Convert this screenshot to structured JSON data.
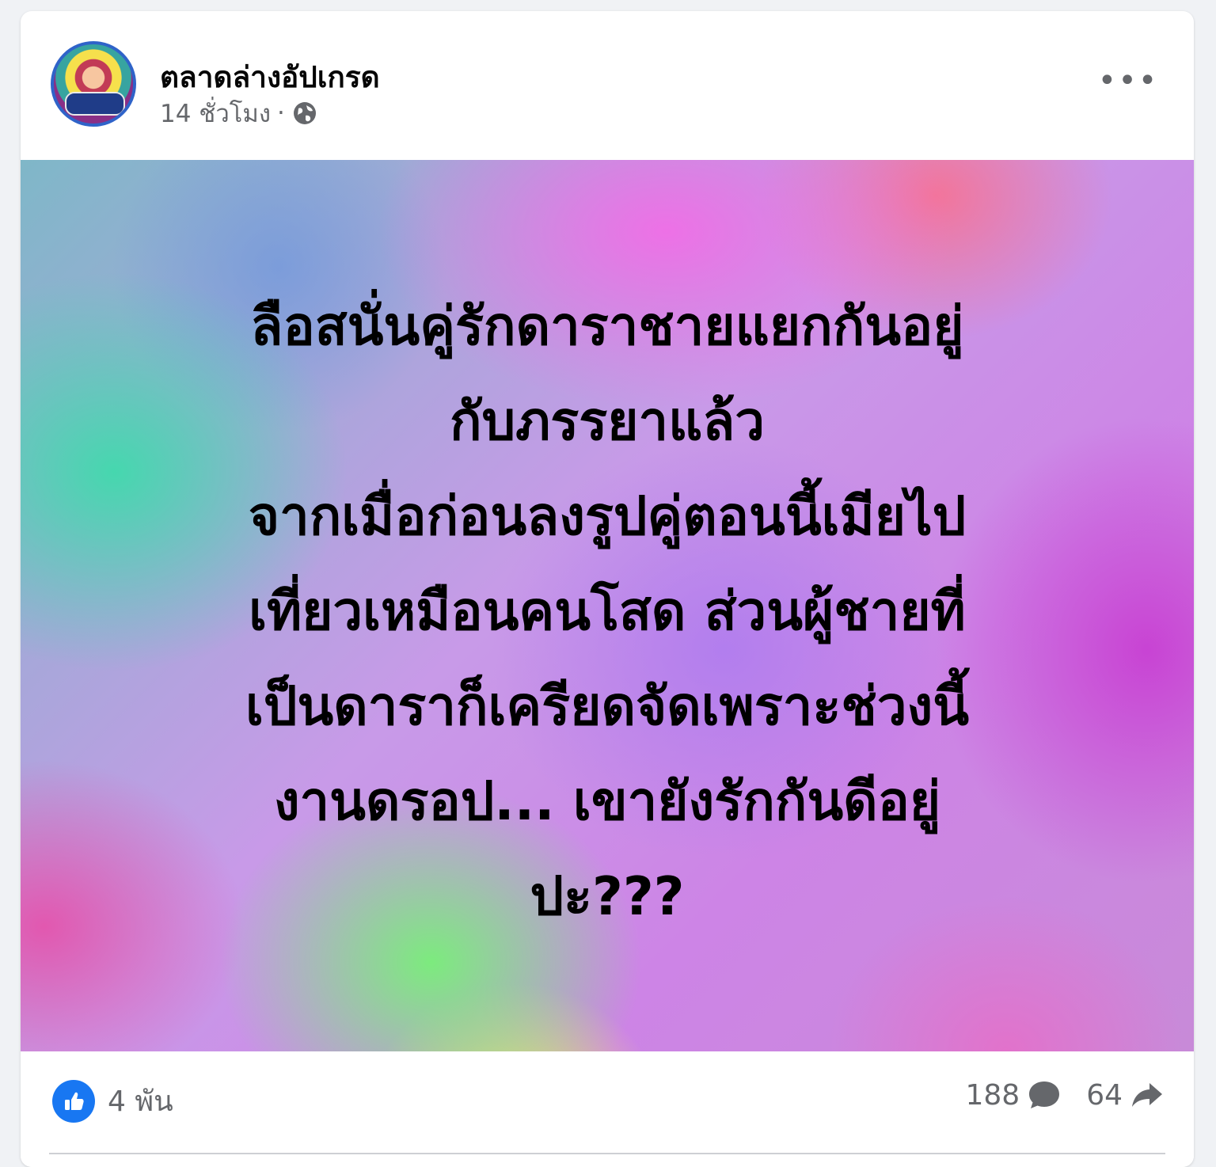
{
  "post": {
    "page_name": "ตลาดล่างอัปเกรด",
    "time": "14 ชั่วโมง",
    "separator": "·",
    "privacy_icon": "globe-icon",
    "more_label": "•••",
    "text_lines": [
      "ลือสนั่นคู่รักดาราชายแยกกันอยู่",
      "กับภรรยาแล้ว",
      "จากเมื่อก่อนลงรูปคู่ตอนนี้เมียไป",
      "เที่ยวเหมือนคนโสด ส่วนผู้ชายที่",
      "เป็นดาราก็เครียดจัดเพราะช่วงนี้",
      "งานดรอป... เขายังรักกันดีอยู่",
      "ปะ???"
    ],
    "background_colors": [
      "#3cdcaa",
      "#78f078",
      "#f0fa5a",
      "#e650aa",
      "#f06ee6",
      "#fa6e8c",
      "#c83cd2",
      "#aa78f0"
    ]
  },
  "footer": {
    "reaction_icon": "like-icon",
    "reaction_count": "4 พัน",
    "comment_count": "188",
    "comment_icon": "comment-icon",
    "share_count": "64",
    "share_icon": "share-icon"
  },
  "colors": {
    "accent": "#1877f2",
    "secondary_text": "#65676b",
    "avatar_ring": "#2f63c9"
  }
}
